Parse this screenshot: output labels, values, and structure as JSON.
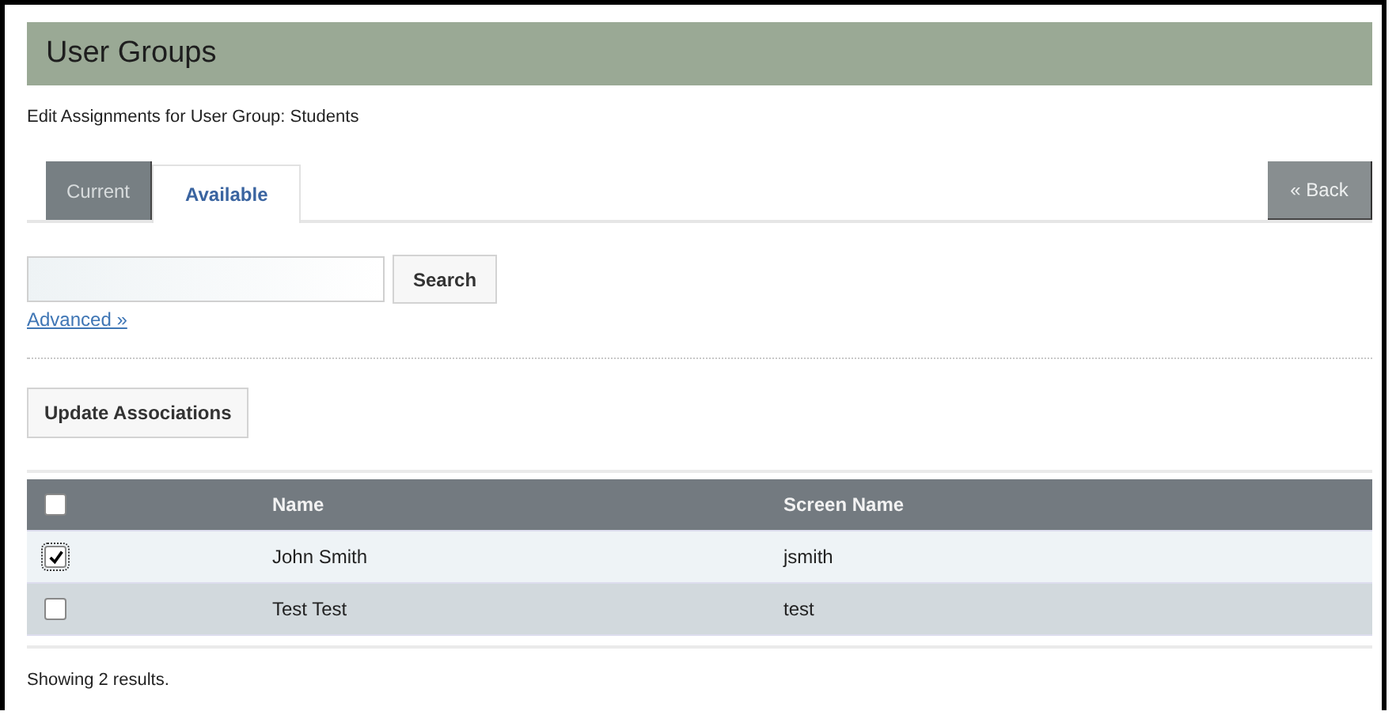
{
  "header": {
    "title": "User Groups"
  },
  "subtitle": "Edit Assignments for User Group: Students",
  "tabs": [
    {
      "label": "Current",
      "selected": false
    },
    {
      "label": "Available",
      "selected": true
    }
  ],
  "back_button": "« Back",
  "search": {
    "button": "Search",
    "advanced_link": "Advanced »"
  },
  "update_button": "Update Associations",
  "table": {
    "select_all_checked": false,
    "columns": [
      "Name",
      "Screen Name"
    ],
    "rows": [
      {
        "checked": true,
        "cells": [
          "John Smith",
          "jsmith"
        ]
      },
      {
        "checked": false,
        "cells": [
          "Test Test",
          "test"
        ]
      }
    ]
  },
  "status": "Showing 2 results."
}
